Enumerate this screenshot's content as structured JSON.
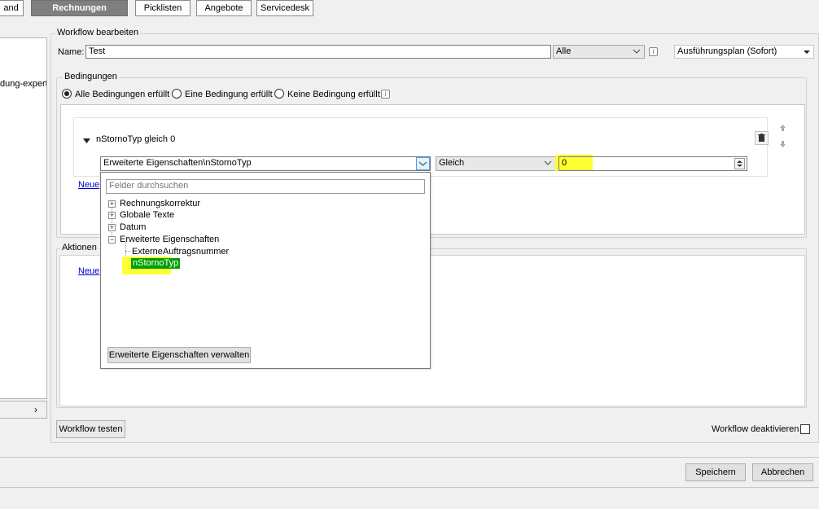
{
  "tabs": [
    {
      "label": "and",
      "active": false
    },
    {
      "label": "Rechnungen",
      "active": true
    },
    {
      "label": "Picklisten",
      "active": false
    },
    {
      "label": "Angebote",
      "active": false
    },
    {
      "label": "Servicedesk",
      "active": false
    }
  ],
  "left_panel": {
    "partial_text": "dung-expert",
    "scroll_arrow": "›"
  },
  "workflow": {
    "group_title": "Workflow bearbeiten",
    "name_label": "Name:",
    "name_value": "Test",
    "scope_select": "Alle",
    "plan_select": "Ausführungsplan (Sofort)"
  },
  "conditions": {
    "group_title": "Bedingungen",
    "radio_all": "Alle Bedingungen erfüllt",
    "radio_one": "Eine Bedingung erfüllt",
    "radio_none": "Keine Bedingung erfüllt",
    "selected": "all",
    "rule_title": "nStornoTyp gleich 0",
    "field_select": "Erweiterte Eigenschaften\\nStornoTyp",
    "operator_select": "Gleich",
    "value_input": "0",
    "new_link": "Neue"
  },
  "field_dropdown": {
    "search_placeholder": "Felder durchsuchen",
    "tree": [
      {
        "label": "Rechnungskorrektur",
        "expanded": false
      },
      {
        "label": "Globale Texte",
        "expanded": false
      },
      {
        "label": "Datum",
        "expanded": false
      },
      {
        "label": "Erweiterte Eigenschaften",
        "expanded": true,
        "children": [
          "ExterneAuftragsnummer",
          "nStornoTyp"
        ]
      }
    ],
    "selected_item": "nStornoTyp",
    "manage_button": "Erweiterte Eigenschaften verwalten"
  },
  "actions": {
    "group_title": "Aktionen",
    "new_link": "Neue"
  },
  "footer": {
    "test_button": "Workflow testen",
    "deactivate_label": "Workflow deaktivieren",
    "deactivate_checked": false,
    "save_button": "Speichern",
    "cancel_button": "Abbrechen"
  },
  "colors": {
    "active_tab": "#7f7f7f",
    "highlight_yellow": "#ffff33",
    "selected_green": "#00a000",
    "link_blue": "#0000d0"
  },
  "icons": {
    "info": "info-icon",
    "trash": "trash-icon",
    "move_up": "arrow-up-icon",
    "move_down": "arrow-down-icon",
    "collapse": "triangle-down-icon"
  }
}
